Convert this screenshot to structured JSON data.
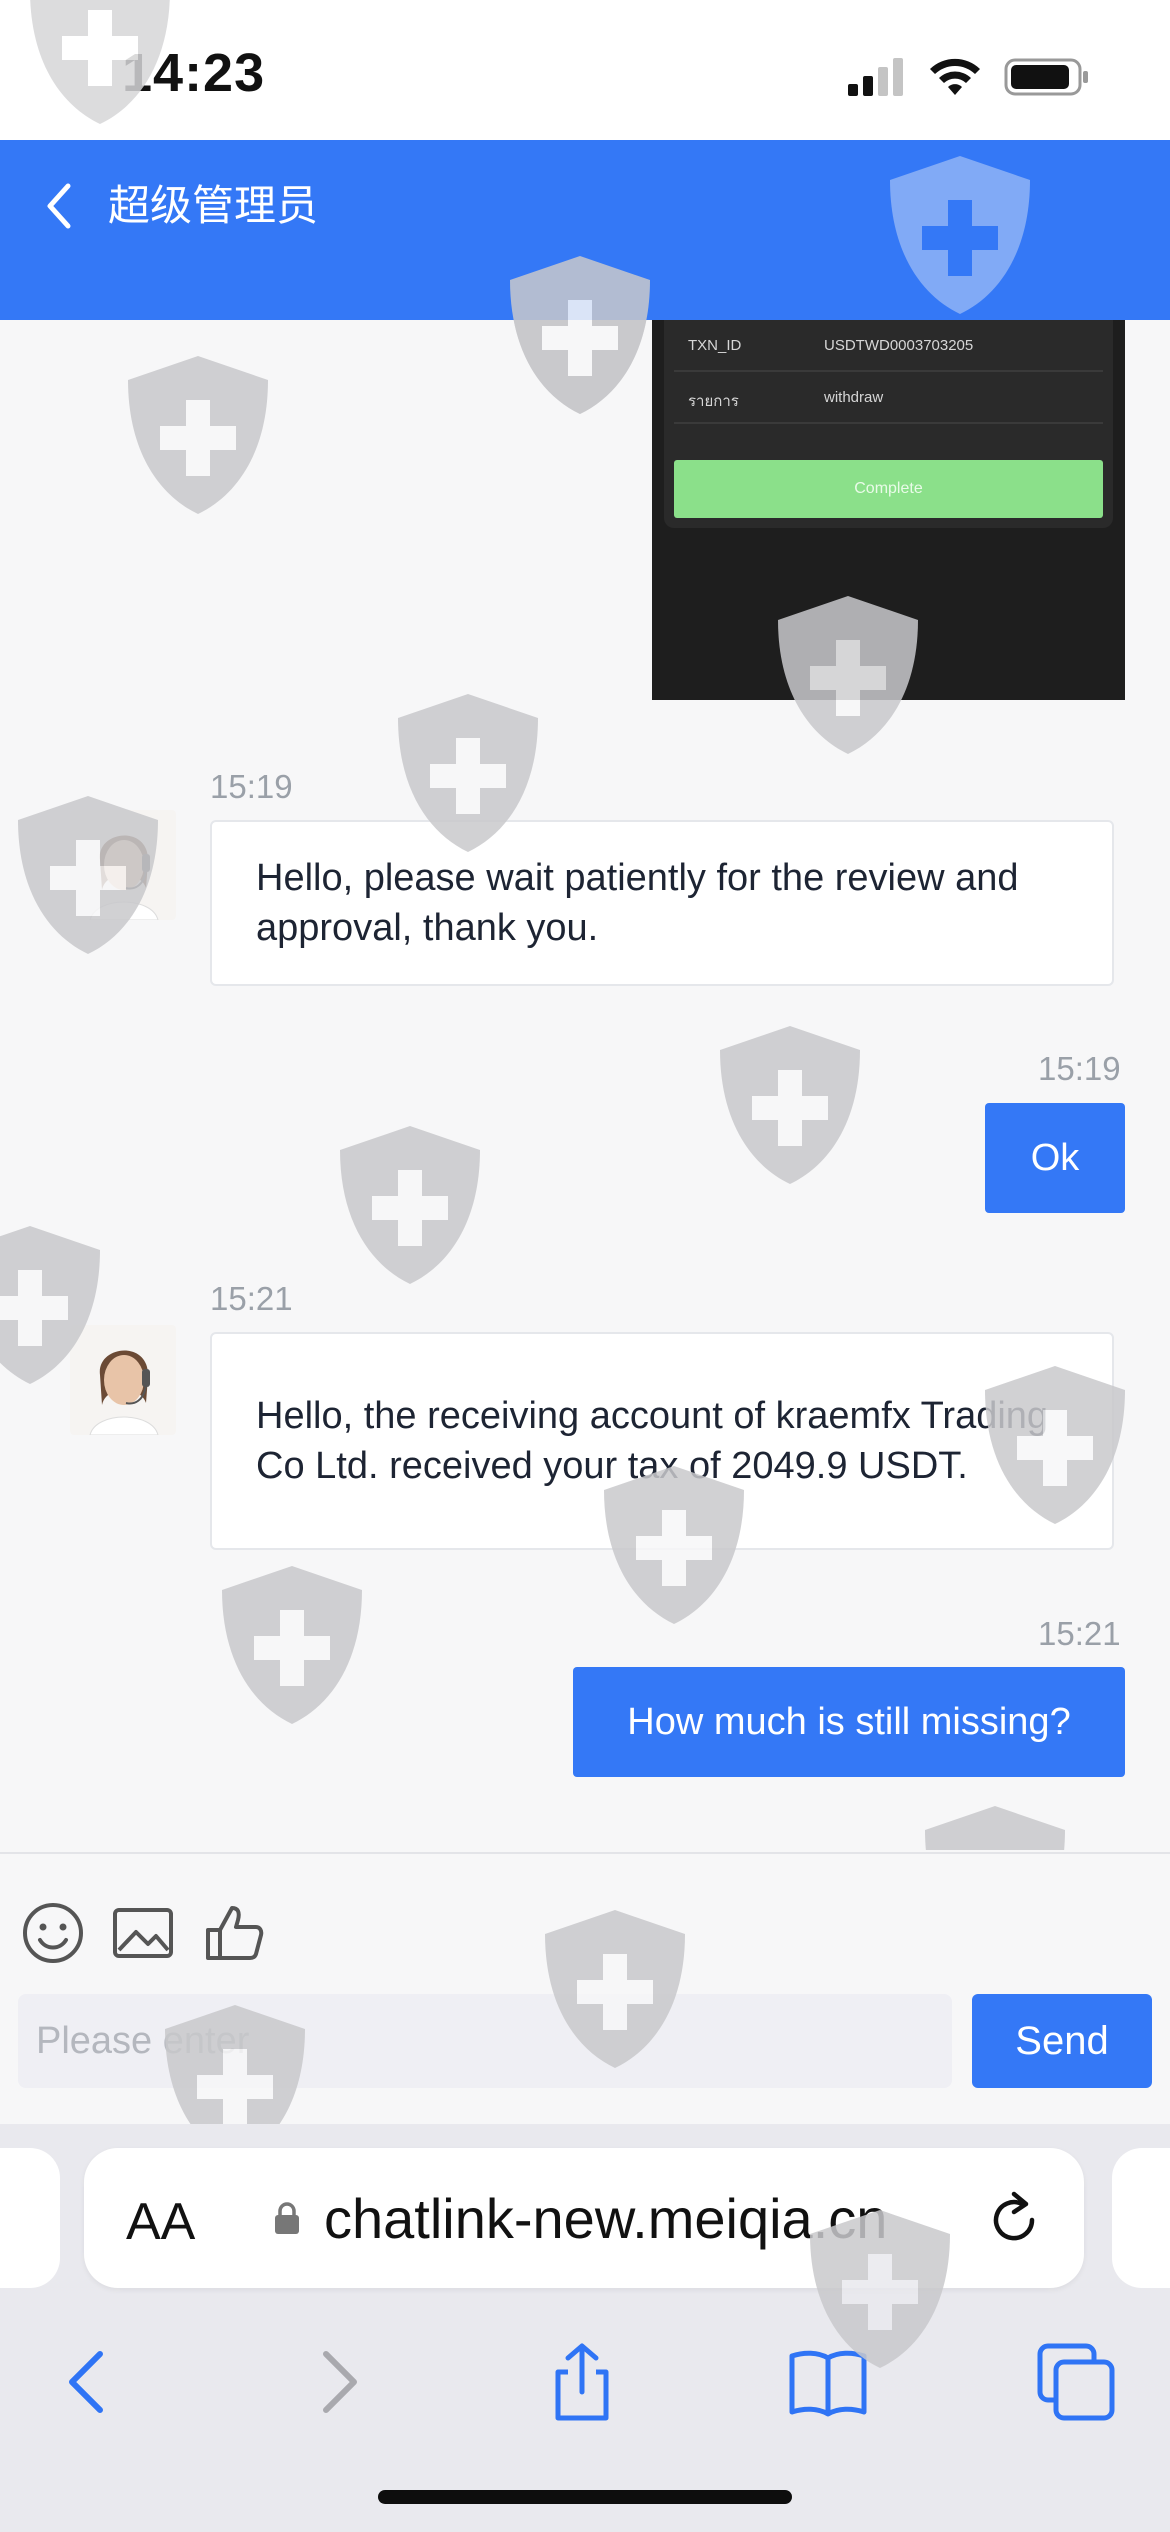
{
  "status_bar": {
    "time": "14:23"
  },
  "header": {
    "title": "超级管理员"
  },
  "receipt": {
    "rows": [
      {
        "key": "TXN_ID",
        "value": "USDTWD0003703205"
      },
      {
        "key": "รายการ",
        "value": "withdraw"
      }
    ],
    "button_label": "Complete"
  },
  "messages": [
    {
      "time": "15:19",
      "direction": "incoming",
      "text": "Hello, please wait patiently for the review and approval, thank you."
    },
    {
      "time": "15:19",
      "direction": "outgoing",
      "text": "Ok"
    },
    {
      "time": "15:21",
      "direction": "incoming",
      "text": "Hello, the receiving account of kraemfx Trading Co Ltd. received your tax of 2049.9 USDT."
    },
    {
      "time": "15:21",
      "direction": "outgoing",
      "text": "How much is still missing?"
    }
  ],
  "composer": {
    "tools": [
      "emoji-icon",
      "image-icon",
      "thumbs-up-icon"
    ],
    "placeholder": "Please enter",
    "send_label": "Send"
  },
  "browser": {
    "text_size_label": "AA",
    "url": "chatlink-new.meiqia.cn"
  },
  "colors": {
    "accent": "#3478f6",
    "complete_green": "#8be08a"
  }
}
